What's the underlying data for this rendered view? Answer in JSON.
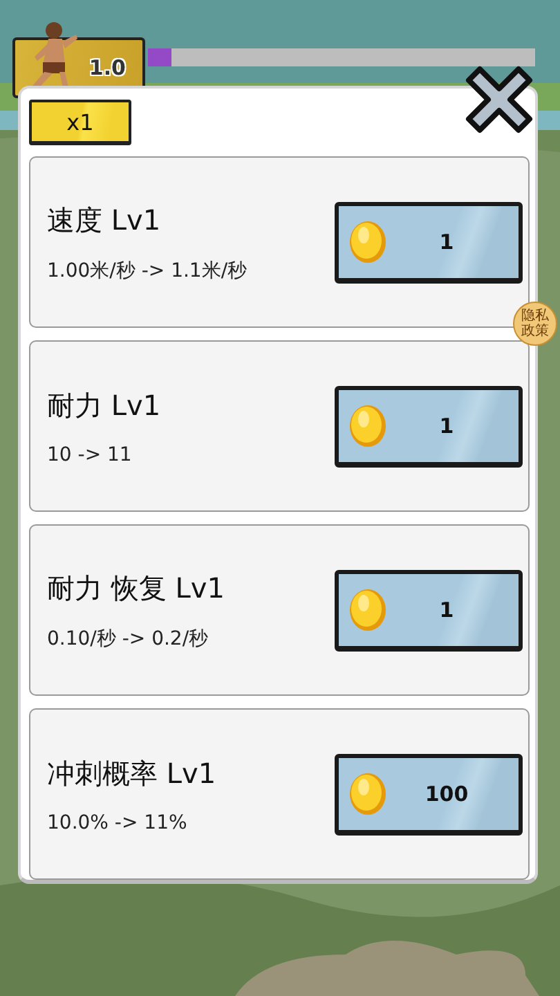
{
  "hud": {
    "speed": "1.0",
    "progress": {
      "level": 0.06
    }
  },
  "panel": {
    "multiplier": "x1",
    "upgrades": [
      {
        "title": "速度 Lv1",
        "effect": "1.00米/秒 -> 1.1米/秒",
        "cost": "1"
      },
      {
        "title": "耐力 Lv1",
        "effect": "10 -> 11",
        "cost": "1"
      },
      {
        "title": "耐力 恢复 Lv1",
        "effect": "0.10/秒 -> 0.2/秒",
        "cost": "1"
      },
      {
        "title": "冲刺概率 Lv1",
        "effect": "10.0% -> 11%",
        "cost": "100"
      }
    ]
  },
  "privacy_badge": "隐私政策"
}
